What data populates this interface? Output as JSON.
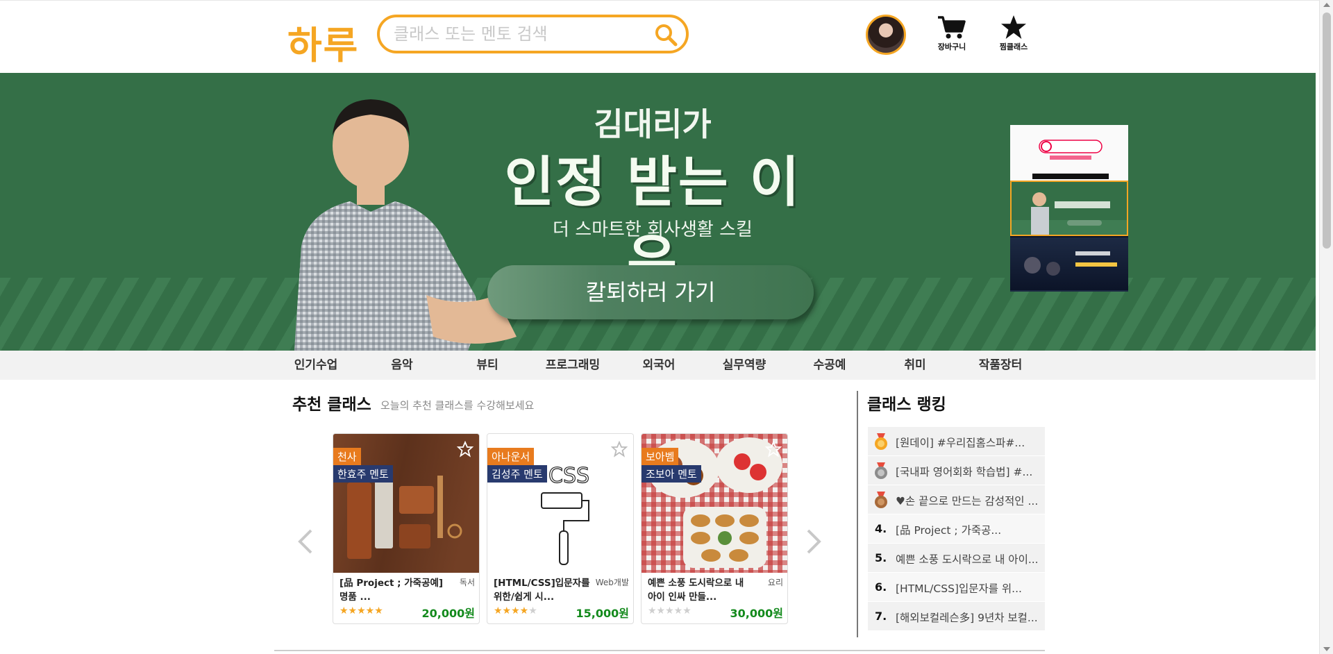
{
  "header": {
    "logo": "하루",
    "search_placeholder": "클래스 또는 멘토 검색",
    "cart_label": "장바구니",
    "wishlist_label": "찜클래스"
  },
  "banner": {
    "line1": "김대리가",
    "headline": "인정 받는 이유",
    "subline": "더 스마트한 회사생활 스킬",
    "cta": "칼퇴하러 가기",
    "slides": [
      "slide-1",
      "slide-2",
      "slide-3"
    ],
    "active_slide": 2
  },
  "categories": [
    "인기수업",
    "음악",
    "뷰티",
    "프로그래밍",
    "외국어",
    "실무역량",
    "수공예",
    "취미",
    "작품장터"
  ],
  "recommend": {
    "title": "추천 클래스",
    "subtitle": "오늘의 추천 클래스를 수강해보세요",
    "cards": [
      {
        "tag1": "천사",
        "tag2": "한효주 멘토",
        "title": "[品 Project ; 가죽공예] 명품 ...",
        "category": "독서",
        "rating": 5,
        "price": "20,000원",
        "favorited": false
      },
      {
        "tag1": "아나운서",
        "tag2": "김성주 멘토",
        "title": "[HTML/CSS]입문자를 위한/쉽게 시...",
        "category": "Web개발",
        "rating": 4,
        "price": "15,000원",
        "favorited": false
      },
      {
        "tag1": "보아벰",
        "tag2": "조보아 멘토",
        "title": "예쁜 소풍 도시락으로 내 아이 인싸 만들...",
        "category": "요리",
        "rating": 0,
        "price": "30,000원",
        "favorited": false
      }
    ]
  },
  "ranking": {
    "title": "클래스 랭킹",
    "items": [
      {
        "rank": "1.",
        "medal": "gold",
        "text": "[원데이] #우리집홈스파#..."
      },
      {
        "rank": "2.",
        "medal": "silver",
        "text": "[국내파 영어회화 학습법] #..."
      },
      {
        "rank": "3.",
        "medal": "bronze",
        "text": "♥손 끝으로 만드는 감성적인 ..."
      },
      {
        "rank": "4.",
        "medal": "",
        "text": "[品 Project ; 가죽공..."
      },
      {
        "rank": "5.",
        "medal": "",
        "text": "예쁜 소풍 도시락으로 내 아이..."
      },
      {
        "rank": "6.",
        "medal": "",
        "text": "[HTML/CSS]입문자를 위..."
      },
      {
        "rank": "7.",
        "medal": "",
        "text": "[해외보컬레슨多] 9년차 보컬..."
      }
    ]
  },
  "colors": {
    "accent": "#f5a623",
    "banner_green": "#346f47",
    "price_green": "#138a1c",
    "tag_orange": "#e87b1e",
    "tag_navy": "#283a6e"
  }
}
